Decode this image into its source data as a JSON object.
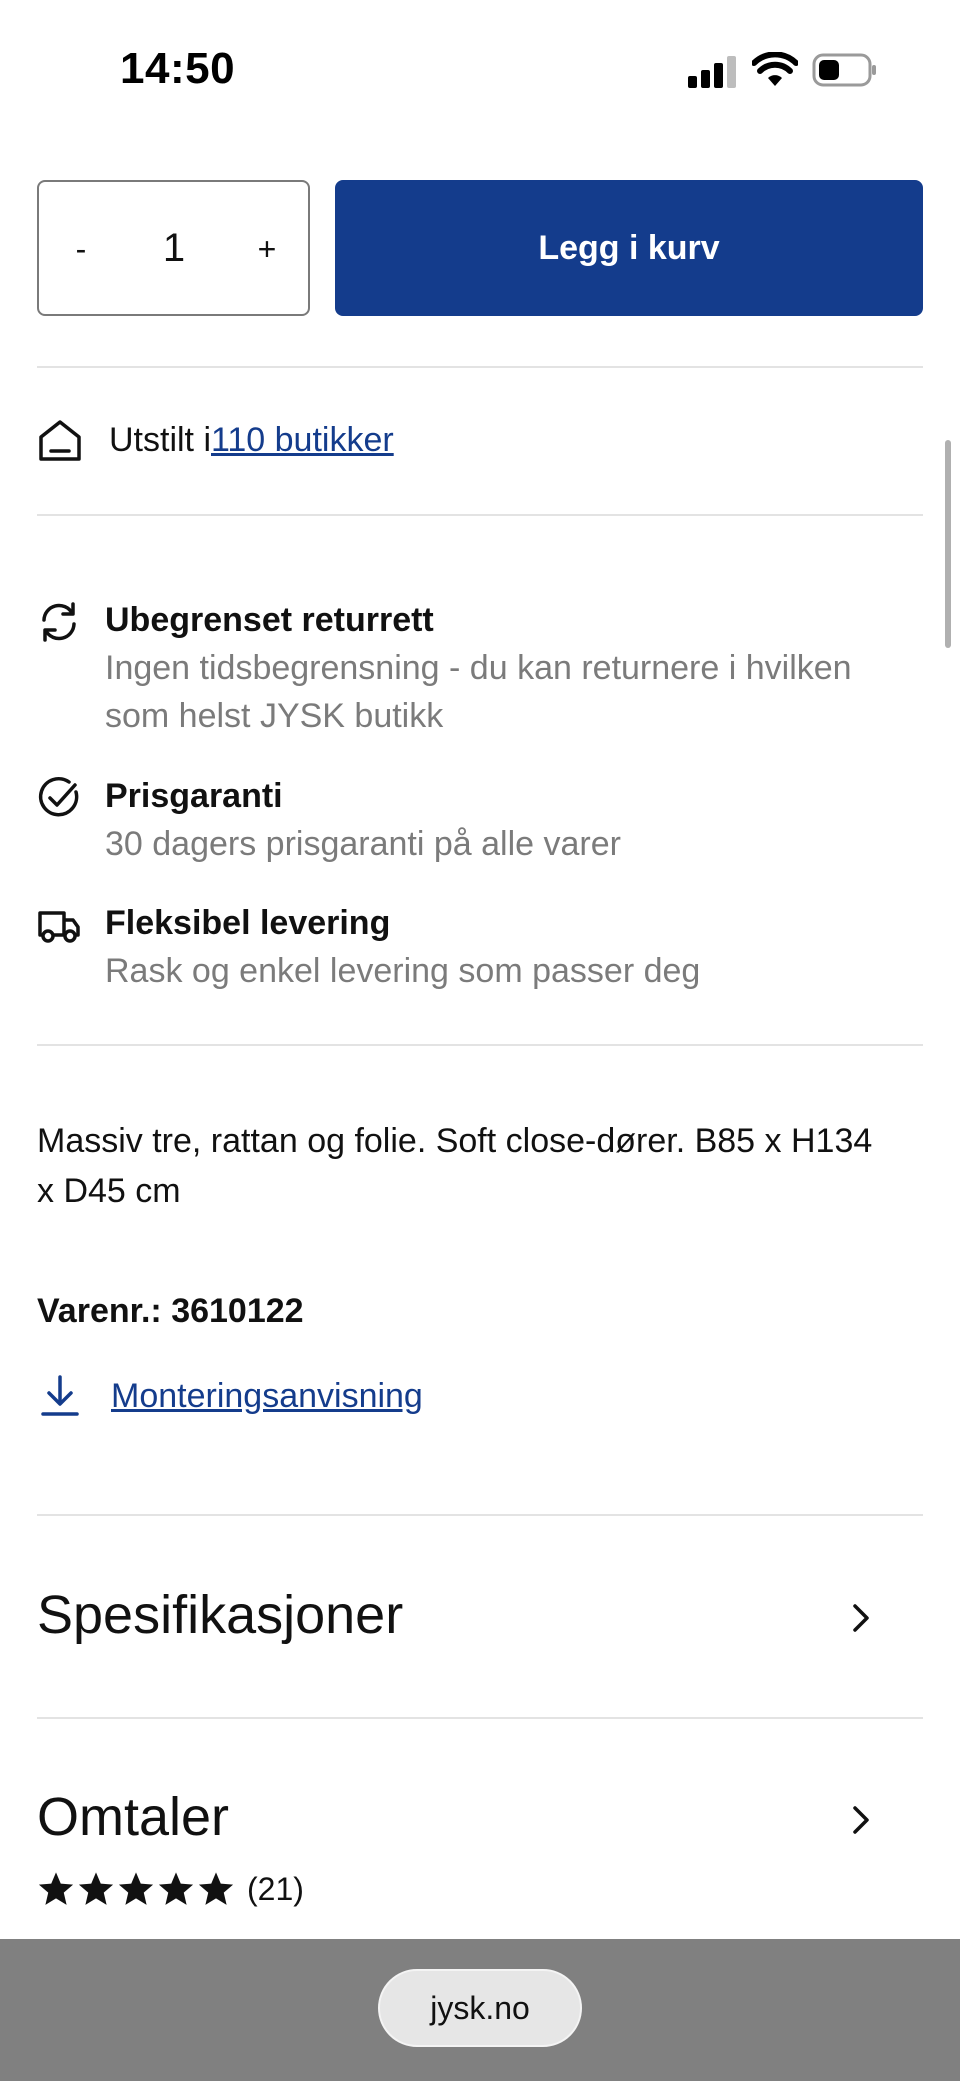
{
  "status_bar": {
    "time": "14:50"
  },
  "quantity": {
    "minus_label": "-",
    "value": "1",
    "plus_label": "+"
  },
  "cart_button": {
    "label": "Legg i kurv",
    "color": "#143c8c"
  },
  "store": {
    "prefix": "Utstilt i ",
    "link_text": "110 butikker"
  },
  "usps": [
    {
      "icon": "refresh-icon",
      "title": "Ubegrenset returrett",
      "line1": "Ingen tidsbegrensning - du kan returnere i hvilken",
      "line2": "som helst JYSK butikk"
    },
    {
      "icon": "check-circle-icon",
      "title": "Prisgaranti",
      "line1": "30 dagers prisgaranti på alle varer"
    },
    {
      "icon": "truck-icon",
      "title": "Fleksibel levering",
      "line1": "Rask og enkel levering som passer deg"
    }
  ],
  "description": {
    "line1": "Massiv tre, rattan og folie. Soft close-dører. B85 x H134",
    "line2": "x D45 cm"
  },
  "article_number": "Varenr.: 3610122",
  "download": {
    "label": "Monteringsanvisning"
  },
  "accordions": {
    "specs": "Spesifikasjoner",
    "reviews": "Omtaler"
  },
  "rating": {
    "stars": 5,
    "count": "(21)"
  },
  "browser": {
    "url": "jysk.no"
  }
}
